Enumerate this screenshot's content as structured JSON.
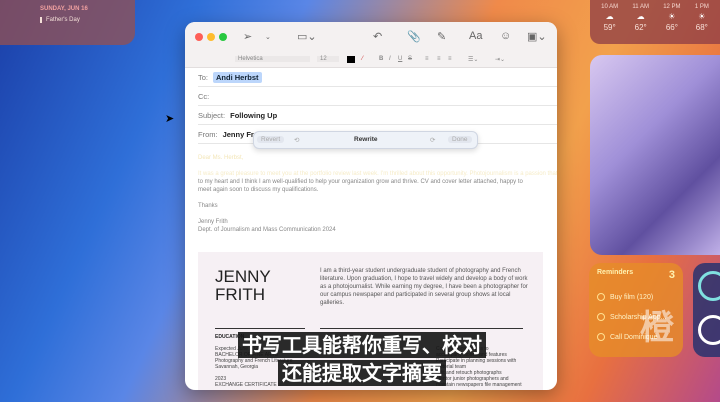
{
  "calendar": {
    "date": "SUNDAY, JUN 16",
    "event": "Father's Day"
  },
  "weather": [
    {
      "time": "10 AM",
      "temp": "59°",
      "icon": "partly-cloudy-icon"
    },
    {
      "time": "11 AM",
      "temp": "62°",
      "icon": "partly-cloudy-icon"
    },
    {
      "time": "12 PM",
      "temp": "66°",
      "icon": "sun-icon"
    },
    {
      "time": "1 PM",
      "temp": "68°",
      "icon": "sun-icon"
    }
  ],
  "reminders": {
    "title": "Reminders",
    "count": "3",
    "items": [
      "Buy film (120)",
      "Scholarship App...",
      "Call Dominique"
    ]
  },
  "format": {
    "font": "Helvetica",
    "size": "12"
  },
  "mail": {
    "to_label": "To:",
    "to": "Andi Herbst",
    "cc_label": "Cc:",
    "subject_label": "Subject:",
    "subject": "Following Up",
    "from_label": "From:",
    "from": "Jenny Fr",
    "greeting": "Dear Ms. Herbst,",
    "para1": "It was a great pleasure to meet you at the portfolio review last week. I'm thrilled about this opportunity. Photojournalism is a passion that is close",
    "para2": "to my heart and I think I am well-qualified to help your organization grow and thrive. CV and cover letter attached, happy to meet again soon to discuss my qualifications.",
    "thanks": "Thanks",
    "sig_name": "Jenny Frith",
    "sig_dept": "Dept. of Journalism and Mass Communication 2024"
  },
  "rewrite": {
    "revert": "Revert",
    "title": "Rewrite",
    "done": "Done"
  },
  "resume": {
    "name": "JENNY FRITH",
    "bio": "I am a third-year student undergraduate student of photography and French literature. Upon graduation, I hope to travel widely and develop a body of work as a photojournalist. While earning my degree, I have been a photographer for our campus newspaper and participated in several group shows at local galleries.",
    "edu": "EDUCATION",
    "edu_lines": [
      "Expected June 2024",
      "BACHELOR OF FINE ARTS",
      "Photography and French Literature",
      "Savannah, Georgia",
      "",
      "2023",
      "EXCHANGE CERTIFICATE"
    ],
    "right_lines": [
      "Capture photographs to",
      "accompany stories and features",
      "Participate in planning sessions with",
      "editorial team",
      "Edit and retouch photographs",
      "Mentor junior photographers and",
      "maintain newspapers file management"
    ]
  },
  "subtitles": [
    "书写工具能帮你重写、校对",
    "还能提取文字摘要"
  ]
}
